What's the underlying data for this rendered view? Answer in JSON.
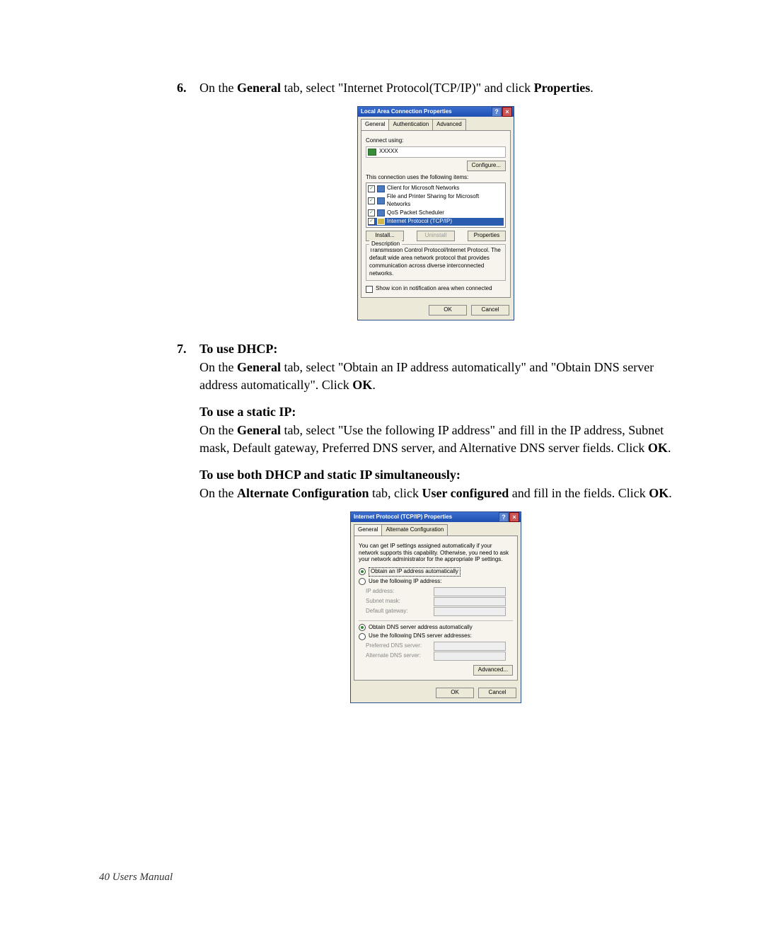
{
  "steps": {
    "s6": {
      "num": "6.",
      "text_pre": "On the ",
      "bold1": "General",
      "text_mid": " tab, select \"Internet Protocol(TCP/IP)\" and click ",
      "bold2": "Properties",
      "text_post": "."
    },
    "s7": {
      "num": "7.",
      "heading": "To use DHCP:",
      "p1_pre": "On the ",
      "p1_b1": "General",
      "p1_mid": " tab, select \"Obtain an IP address automatically\" and \"Obtain DNS server address automatically\". Click ",
      "p1_b2": "OK",
      "p1_post": ".",
      "h2": "To use a static IP:",
      "p2_pre": "On the ",
      "p2_b1": "General",
      "p2_mid": " tab, select \"Use the following IP address\" and fill in the IP address, Subnet mask, Default gateway, Preferred DNS server, and Alternative DNS server fields. Click ",
      "p2_b2": "OK",
      "p2_post": ".",
      "h3": "To use both DHCP and static IP simultaneously:",
      "p3_pre": "On the ",
      "p3_b1": "Alternate Configuration",
      "p3_mid": " tab, click ",
      "p3_b2": "User configured",
      "p3_mid2": " and fill in the fields. Click ",
      "p3_b3": "OK",
      "p3_post": "."
    }
  },
  "dialog1": {
    "title": "Local Area Connection Properties",
    "tabs": {
      "general": "General",
      "auth": "Authentication",
      "adv": "Advanced"
    },
    "connect_using": "Connect using:",
    "nic_name": "XXXXX",
    "configure": "Configure...",
    "uses_label": "This connection uses the following items:",
    "items": {
      "i0": "Client for Microsoft Networks",
      "i1": "File and Printer Sharing for Microsoft Networks",
      "i2": "QoS Packet Scheduler",
      "i3": "Internet Protocol (TCP/IP)"
    },
    "install": "Install...",
    "uninstall": "Uninstall",
    "properties": "Properties",
    "desc_legend": "Description",
    "description": "Transmission Control Protocol/Internet Protocol. The default wide area network protocol that provides communication across diverse interconnected networks.",
    "show_icon": "Show icon in notification area when connected",
    "ok": "OK",
    "cancel": "Cancel"
  },
  "dialog2": {
    "title": "Internet Protocol (TCP/IP) Properties",
    "tabs": {
      "general": "General",
      "alt": "Alternate Configuration"
    },
    "intro": "You can get IP settings assigned automatically if your network supports this capability. Otherwise, you need to ask your network administrator for the appropriate IP settings.",
    "r_obtain_ip": "Obtain an IP address automatically",
    "r_use_ip": "Use the following IP address:",
    "ip_address": "IP address:",
    "subnet": "Subnet mask:",
    "gateway": "Default gateway:",
    "r_obtain_dns": "Obtain DNS server address automatically",
    "r_use_dns": "Use the following DNS server addresses:",
    "pref_dns": "Preferred DNS server:",
    "alt_dns": "Alternate DNS server:",
    "advanced": "Advanced...",
    "ok": "OK",
    "cancel": "Cancel"
  },
  "footer": "40  Users Manual"
}
